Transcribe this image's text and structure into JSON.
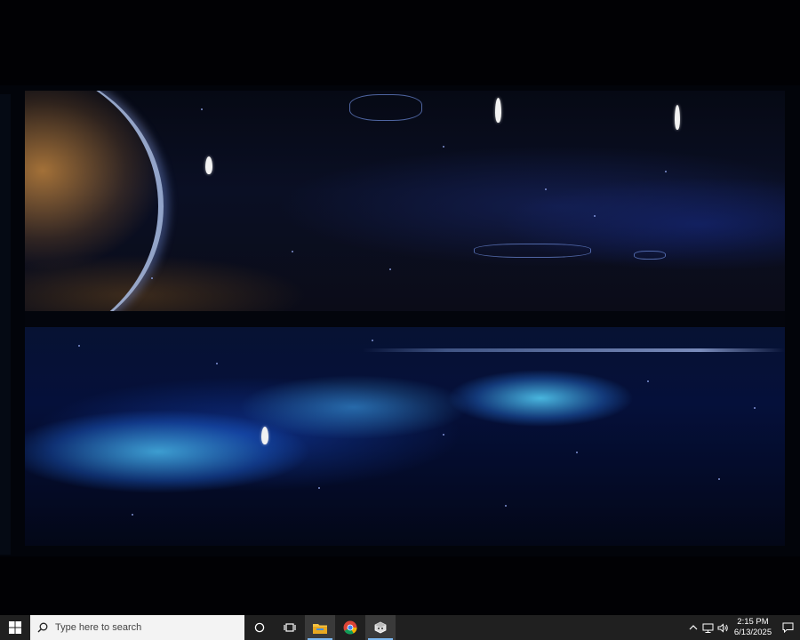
{
  "taskbar": {
    "search_placeholder": "Type here to search",
    "clock_time": "2:15 PM",
    "clock_date": "6/13/2025",
    "pinned_apps": [
      {
        "name": "cortana-icon",
        "active": false
      },
      {
        "name": "task-view-icon",
        "active": false
      },
      {
        "name": "file-explorer-icon",
        "active": true
      },
      {
        "name": "chrome-icon",
        "active": false
      },
      {
        "name": "game-app-icon",
        "active": true
      }
    ],
    "tray_icons": [
      "chevron-up-icon",
      "network-icon",
      "volume-icon"
    ],
    "accent_color": "#7cb8f0"
  },
  "game": {
    "colors": {
      "space_dark": "#02040a",
      "nebula_blue": "#50c8f0",
      "sunset_glow": "#be823c",
      "ship": "#f2f2f2"
    },
    "ship_icons": [
      "ship-icon",
      "ship-icon",
      "ship-icon",
      "ship-icon"
    ]
  }
}
